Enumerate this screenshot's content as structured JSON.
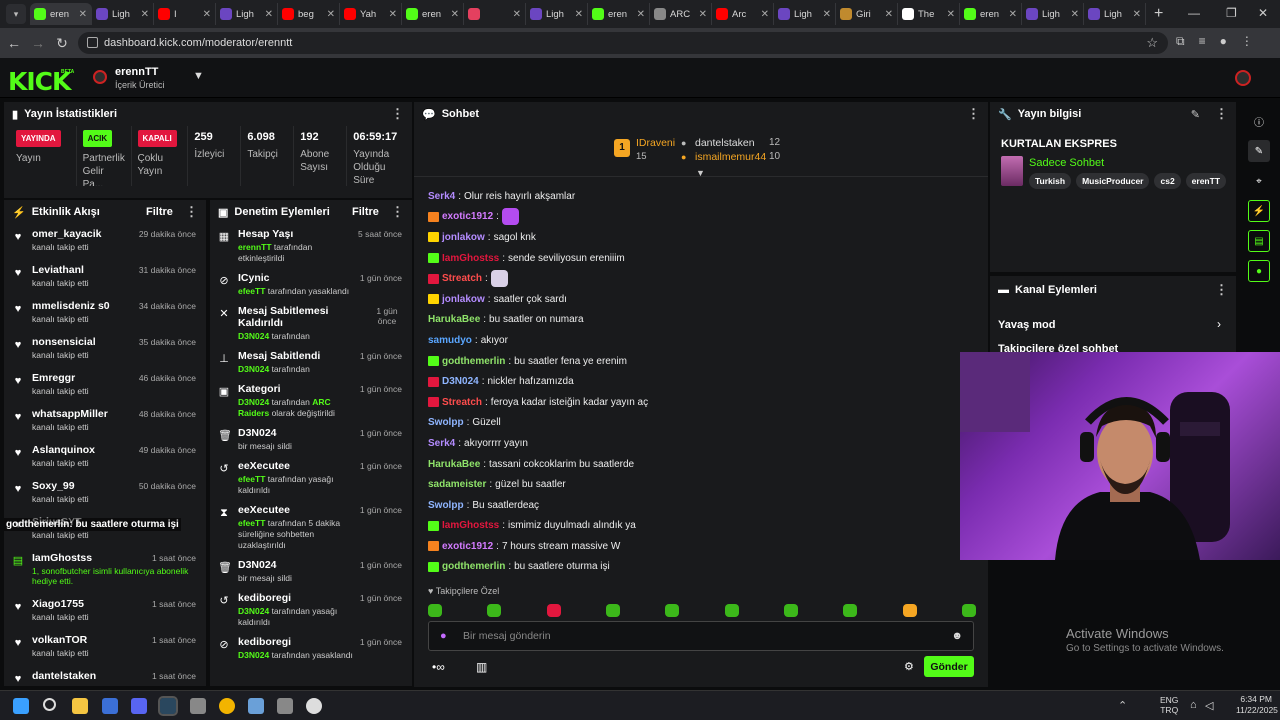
{
  "browser": {
    "tabs": [
      {
        "title": "eren",
        "color": "#53fc18"
      },
      {
        "title": "Ligh",
        "color": "#6b46c1"
      },
      {
        "title": "I",
        "color": "#ff0000"
      },
      {
        "title": "Ligh",
        "color": "#6b46c1"
      },
      {
        "title": "beg",
        "color": "#ff0000"
      },
      {
        "title": "Yah",
        "color": "#ff0000"
      },
      {
        "title": "eren",
        "color": "#53fc18"
      },
      {
        "title": "",
        "color": "#e4405f"
      },
      {
        "title": "Ligh",
        "color": "#6b46c1"
      },
      {
        "title": "eren",
        "color": "#53fc18"
      },
      {
        "title": "ARC",
        "color": "#888888"
      },
      {
        "title": "Arc",
        "color": "#ff0000"
      },
      {
        "title": "Ligh",
        "color": "#6b46c1"
      },
      {
        "title": "Giri",
        "color": "#c08a2e"
      },
      {
        "title": "The",
        "color": "#ffffff"
      },
      {
        "title": "eren",
        "color": "#53fc18"
      },
      {
        "title": "Ligh",
        "color": "#6b46c1"
      },
      {
        "title": "Ligh",
        "color": "#6b46c1"
      }
    ],
    "url": "dashboard.kick.com/moderator/erenntt"
  },
  "header": {
    "logo": "KICK",
    "beta": "BETA",
    "channel": "erennTT",
    "role": "İçerik Üretici"
  },
  "stats": {
    "title": "Yayın İstatistikleri",
    "items": [
      {
        "badge": "YAYINDA",
        "badge_color": "#e2173e",
        "label": "Yayın"
      },
      {
        "badge": "ACIK",
        "badge_color": "#53fc18",
        "label": "Partnerlik Gelir Pa..."
      },
      {
        "badge": "KAPALI",
        "badge_color": "#e2173e",
        "label": "Çoklu Yayın"
      },
      {
        "value": "259",
        "label": "İzleyici"
      },
      {
        "value": "6.098",
        "label": "Takipçi"
      },
      {
        "value": "192",
        "label": "Abone Sayısı"
      },
      {
        "value": "06:59:17",
        "label": "Yayında Olduğu Süre"
      }
    ]
  },
  "activity": {
    "title": "Etkinlik Akışı",
    "filter": "Filtre",
    "items": [
      {
        "name": "omer_kayacik",
        "desc": "kanalı takip etti",
        "time": "29 dakika önce",
        "icon": "heart-icon",
        "glyph": "♥"
      },
      {
        "name": "Leviathanl",
        "desc": "kanalı takip etti",
        "time": "31 dakika önce",
        "icon": "heart-icon",
        "glyph": "♥"
      },
      {
        "name": "mmelisdeniz s0",
        "desc": "kanalı takip etti",
        "time": "34 dakika önce",
        "icon": "heart-icon",
        "glyph": "♥"
      },
      {
        "name": "nonsensicial",
        "desc": "kanalı takip etti",
        "time": "35 dakika önce",
        "icon": "heart-icon",
        "glyph": "♥"
      },
      {
        "name": "Emreggr",
        "desc": "kanalı takip etti",
        "time": "46 dakika önce",
        "icon": "heart-icon",
        "glyph": "♥"
      },
      {
        "name": "whatsappMiller",
        "desc": "kanalı takip etti",
        "time": "48 dakika önce",
        "icon": "heart-icon",
        "glyph": "♥"
      },
      {
        "name": "Aslanquinox",
        "desc": "kanalı takip etti",
        "time": "49 dakika önce",
        "icon": "heart-icon",
        "glyph": "♥"
      },
      {
        "name": "Soxy_99",
        "desc": "kanalı takip etti",
        "time": "50 dakika önce",
        "icon": "heart-icon",
        "glyph": "♥"
      },
      {
        "name": "SiriusSYT",
        "desc": "kanalı takip etti",
        "time": "",
        "icon": "heart-icon",
        "glyph": "♥"
      },
      {
        "name": "IamGhostss",
        "desc": "1, sonofbutcher isimli kullanıcıya abonelik hediye etti.",
        "time": "1 saat önce",
        "icon": "gift-icon",
        "glyph": "▤"
      },
      {
        "name": "Xiago1755",
        "desc": "kanalı takip etti",
        "time": "1 saat önce",
        "icon": "heart-icon",
        "glyph": "♥"
      },
      {
        "name": "volkanTOR",
        "desc": "kanalı takip etti",
        "time": "1 saat önce",
        "icon": "heart-icon",
        "glyph": "♥"
      },
      {
        "name": "dantelstaken",
        "desc": "",
        "time": "1 saat önce",
        "icon": "heart-icon",
        "glyph": "♥"
      }
    ],
    "overlay": "godthemerlin: bu saatlere oturma işi"
  },
  "moderation": {
    "title": "Denetim Eylemleri",
    "filter": "Filtre",
    "items": [
      {
        "title": "Hesap Yaşı",
        "user": "erennTT",
        "desc": "tarafından etkinleştirildi",
        "time": "5 saat önce",
        "icon": "calendar-icon",
        "glyph": "▦"
      },
      {
        "title": "ICynic",
        "user": "efeeTT",
        "desc": "tarafından yasaklandı",
        "time": "1 gün önce",
        "icon": "ban-icon",
        "glyph": "⊘"
      },
      {
        "title": "Mesaj Sabitlemesi Kaldırıldı",
        "user": "D3N024",
        "desc": "tarafından",
        "time": "1 gün önce",
        "icon": "unpin-icon",
        "glyph": "✕"
      },
      {
        "title": "Mesaj Sabitlendi",
        "user": "D3N024",
        "desc": "tarafından",
        "time": "1 gün önce",
        "icon": "pin-icon",
        "glyph": "⊥"
      },
      {
        "title": "Kategori",
        "user": "D3N024",
        "desc": "tarafından",
        "extra": "ARC Raiders",
        "desc2": "olarak değiştirildi",
        "time": "1 gün önce",
        "icon": "category-icon",
        "glyph": "▣"
      },
      {
        "title": "D3N024",
        "user": "",
        "desc": "bir mesajı sildi",
        "time": "1 gün önce",
        "icon": "trash-icon",
        "glyph": "🗑"
      },
      {
        "title": "eeXecutee",
        "user": "efeeTT",
        "desc": "tarafından yasağı kaldırıldı",
        "time": "1 gün önce",
        "icon": "undo-icon",
        "glyph": "↺"
      },
      {
        "title": "eeXecutee",
        "user": "efeeTT",
        "desc": "tarafından 5 dakika süreliğine sohbetten uzaklaştırıldı",
        "time": "1 gün önce",
        "icon": "timeout-icon",
        "glyph": "⧗"
      },
      {
        "title": "D3N024",
        "user": "",
        "desc": "bir mesajı sildi",
        "time": "1 gün önce",
        "icon": "trash-icon",
        "glyph": "🗑"
      },
      {
        "title": "kediboregi",
        "user": "D3N024",
        "desc": "tarafından yasağı kaldırıldı",
        "time": "1 gün önce",
        "icon": "undo-icon",
        "glyph": "↺"
      },
      {
        "title": "kediboregi",
        "user": "D3N024",
        "desc": "tarafından yasaklandı",
        "time": "1 gün önce",
        "icon": "ban-icon",
        "glyph": "⊘"
      }
    ]
  },
  "chat": {
    "title": "Sohbet",
    "top": [
      {
        "rank": "1",
        "name": "IDraveni",
        "count": "15",
        "color": "#f5a623"
      },
      {
        "name": "dantelstaken",
        "count": "12",
        "color": "#dddddd"
      },
      {
        "name": "ismailmemur44",
        "count": "10",
        "color": "#f5a623"
      }
    ],
    "messages": [
      {
        "user": "Serk4",
        "color": "#b48cff",
        "text": "Olur reis hayırlı akşamlar",
        "badge": ""
      },
      {
        "user": "exotic1912",
        "color": "#d37bff",
        "text": "",
        "badge": "#f5821f",
        "emote": true
      },
      {
        "user": "jonlakow",
        "color": "#b48cff",
        "text": "sagol knk",
        "badge": "#ffd400"
      },
      {
        "user": "IamGhostss",
        "color": "#e2173e",
        "text": "sende seviliyosun ereniiim",
        "badge": "#53fc18"
      },
      {
        "user": "Streatch",
        "color": "#ff4d4d",
        "text": "",
        "badge": "#e2173e",
        "emote": true
      },
      {
        "user": "jonlakow",
        "color": "#b48cff",
        "text": "saatler çok sardı",
        "badge": "#ffd400"
      },
      {
        "user": "HarukaBee",
        "color": "#8fe36a",
        "text": "bu saatler on numara",
        "badge": ""
      },
      {
        "user": "samudyo",
        "color": "#5aa6ff",
        "text": "akıyor",
        "badge": ""
      },
      {
        "user": "godthemerlin",
        "color": "#8fe36a",
        "text": "bu saatler fena ye erenim",
        "badge": "#53fc18"
      },
      {
        "user": "D3N024",
        "color": "#8fb5ff",
        "text": "nickler hafızamızda",
        "badge": "#e2173e"
      },
      {
        "user": "Streatch",
        "color": "#ff4d4d",
        "text": "feroya kadar isteiğin kadar yayın aç",
        "badge": "#e2173e"
      },
      {
        "user": "Swolpp",
        "color": "#8fb5ff",
        "text": "Güzell",
        "badge": ""
      },
      {
        "user": "Serk4",
        "color": "#b48cff",
        "text": "akıyorrrr yayın",
        "badge": ""
      },
      {
        "user": "HarukaBee",
        "color": "#8fe36a",
        "text": "tassani cokcoklarim bu saatlerde",
        "badge": ""
      },
      {
        "user": "sadameister",
        "color": "#8fe36a",
        "text": "güzel bu saatler",
        "badge": ""
      },
      {
        "user": "Swolpp",
        "color": "#8fb5ff",
        "text": "Bu saatlerdeaç",
        "badge": ""
      },
      {
        "user": "IamGhostss",
        "color": "#e2173e",
        "text": "ismimiz duyulmadı alındık ya",
        "badge": "#53fc18"
      },
      {
        "user": "exotic1912",
        "color": "#d37bff",
        "text": "7 hours stream massive W",
        "badge": "#f5821f"
      },
      {
        "user": "godthemerlin",
        "color": "#8fe36a",
        "text": "bu saatlere oturma işi",
        "badge": "#53fc18"
      }
    ],
    "mode": "Takipçilere Özel",
    "placeholder": "Bir mesaj gönderin",
    "send": "Gönder"
  },
  "info": {
    "title": "Yayın bilgisi",
    "stream_title": "KURTALAN EKSPRES",
    "category": "Sadece Sohbet",
    "tags": [
      "Turkish",
      "MusicProducer",
      "cs2",
      "erenTT"
    ]
  },
  "actions": {
    "title": "Kanal Eylemleri",
    "items": [
      "Yavaş mod",
      "Takipçilere özel sohbet"
    ]
  },
  "watermark": {
    "line1": "Activate Windows",
    "line2": "Go to Settings to activate Windows."
  },
  "taskbar": {
    "lang": "ENG",
    "layout": "TRQ",
    "time": "6:34 PM",
    "date": "11/22/2025"
  }
}
